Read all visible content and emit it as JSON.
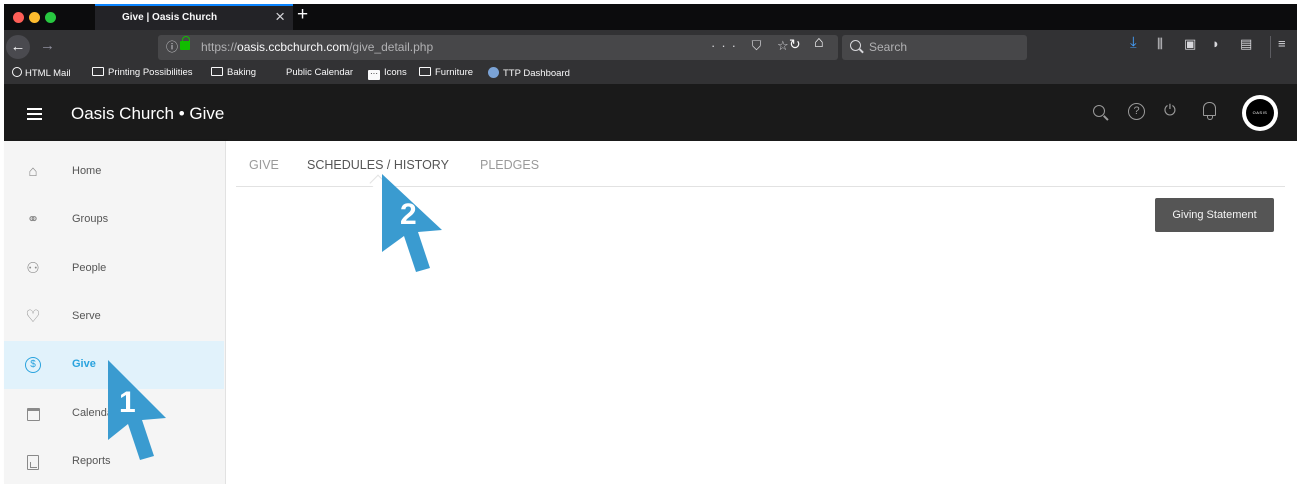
{
  "browser": {
    "tab_title": "Give | Oasis Church",
    "tab_close": "×",
    "new_tab": "+",
    "url_protocol": "https://",
    "url_domain": "oasis.ccbchurch.com",
    "url_path": "/give_detail.php",
    "url_actions": "··· ⛉ ☆",
    "search_placeholder": "Search",
    "back": "←",
    "forward": "→",
    "reload": "↻",
    "home": "⌂",
    "bookmarks": [
      {
        "label": "HTML Mail"
      },
      {
        "label": "Printing Possibilities"
      },
      {
        "label": "Baking"
      },
      {
        "label": "Public Calendar"
      },
      {
        "label": "Icons"
      },
      {
        "label": "Furniture"
      },
      {
        "label": "TTP Dashboard"
      }
    ]
  },
  "app": {
    "title": "Oasis Church • Give",
    "help": "?",
    "power": "⏻",
    "avatar_text": "OASIS"
  },
  "sidebar": {
    "items": [
      {
        "label": "Home",
        "icon": "⌂"
      },
      {
        "label": "Groups",
        "icon": "⚭"
      },
      {
        "label": "People",
        "icon": "⚇"
      },
      {
        "label": "Serve",
        "icon": "♡"
      },
      {
        "label": "Give",
        "icon": "$"
      },
      {
        "label": "Calendar",
        "icon": ""
      },
      {
        "label": "Reports",
        "icon": ""
      }
    ]
  },
  "main": {
    "tabs": [
      {
        "label": "GIVE"
      },
      {
        "label": "SCHEDULES / HISTORY"
      },
      {
        "label": "PLEDGES"
      }
    ],
    "giving_statement_label": "Giving Statement"
  },
  "callouts": [
    {
      "number": "1"
    },
    {
      "number": "2"
    }
  ],
  "colors": {
    "accent": "#2aa3de",
    "callout": "#3a9bd0",
    "header_bg": "#1a1a1a",
    "button_bg": "#555555"
  }
}
